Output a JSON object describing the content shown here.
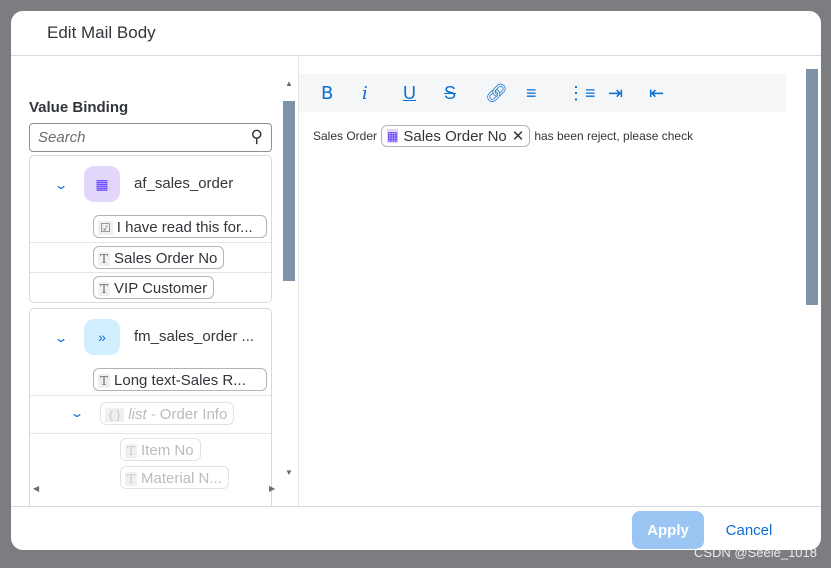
{
  "dialog": {
    "title": "Edit Mail Body"
  },
  "value_binding": {
    "title": "Value Binding",
    "search_placeholder": "Search",
    "groups": [
      {
        "name": "af_sales_order",
        "icon": "form-icon",
        "color": "#e2d7fb",
        "items": [
          "I have read this for...",
          "Sales Order No",
          "VIP Customer"
        ]
      },
      {
        "name": "fm_sales_order ...",
        "icon": "chevrons-icon",
        "color": "#d1efff",
        "items": [
          "Long text-Sales R..."
        ],
        "list": {
          "type": "list -",
          "name": "Order Info",
          "items": [
            "Item No",
            "Material N..."
          ]
        }
      }
    ]
  },
  "toolbar": {
    "buttons": [
      "bold",
      "italic",
      "underline",
      "strikethrough",
      "link",
      "numbered-list",
      "bullet-list",
      "indent",
      "outdent"
    ]
  },
  "editor": {
    "text_before": "Sales Order",
    "token": "Sales Order No",
    "text_after": "has been reject, please check"
  },
  "footer": {
    "apply": "Apply",
    "cancel": "Cancel"
  },
  "watermark": "CSDN @Seele_1018"
}
